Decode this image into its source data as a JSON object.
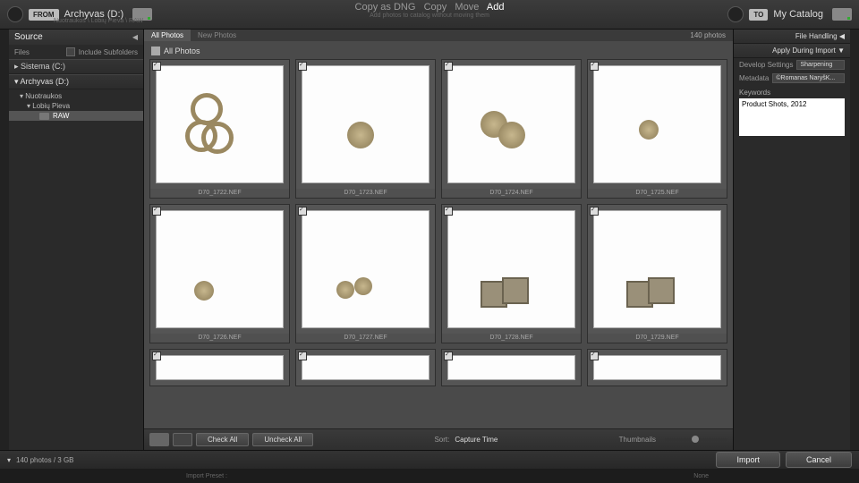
{
  "header": {
    "from_label": "FROM",
    "drive": "Archyvas (D:)",
    "breadcrumb": "Nuotraukos \\ Lobių Pieva \\ RAW",
    "ops": {
      "copy_dng": "Copy as DNG",
      "copy": "Copy",
      "move": "Move",
      "add": "Add"
    },
    "subline": "Add photos to catalog without moving them",
    "to_label": "TO",
    "to_value": "My Catalog"
  },
  "source": {
    "title": "Source",
    "files_label": "Files",
    "include_sub": "Include Subfolders",
    "drives": [
      "Sistema (C:)",
      "Archyvas (D:)"
    ],
    "tree": {
      "root": "Nuotraukos",
      "level1": "Lobių Pieva",
      "level2": "RAW"
    }
  },
  "grid": {
    "tab_all": "All Photos",
    "tab_new": "New Photos",
    "count": "140 photos",
    "section": "All Photos",
    "files": [
      "D70_1722.NEF",
      "D70_1723.NEF",
      "D70_1724.NEF",
      "D70_1725.NEF",
      "D70_1726.NEF",
      "D70_1727.NEF",
      "D70_1728.NEF",
      "D70_1729.NEF"
    ]
  },
  "cfoot": {
    "check_all": "Check All",
    "uncheck_all": "Uncheck All",
    "sort_label": "Sort:",
    "sort_value": "Capture Time",
    "thumb_label": "Thumbnails"
  },
  "right": {
    "fh": "File Handling",
    "adi": "Apply During Import",
    "dev_k": "Develop Settings",
    "dev_v": "Sharpening",
    "meta_k": "Metadata",
    "meta_v": "©Romanas NaryšK...",
    "kw_k": "Keywords",
    "kw_v": "Product Shots, 2012"
  },
  "footer": {
    "status": "140 photos / 3 GB",
    "import": "Import",
    "cancel": "Cancel",
    "preset": "Import Preset :",
    "none": "None"
  }
}
